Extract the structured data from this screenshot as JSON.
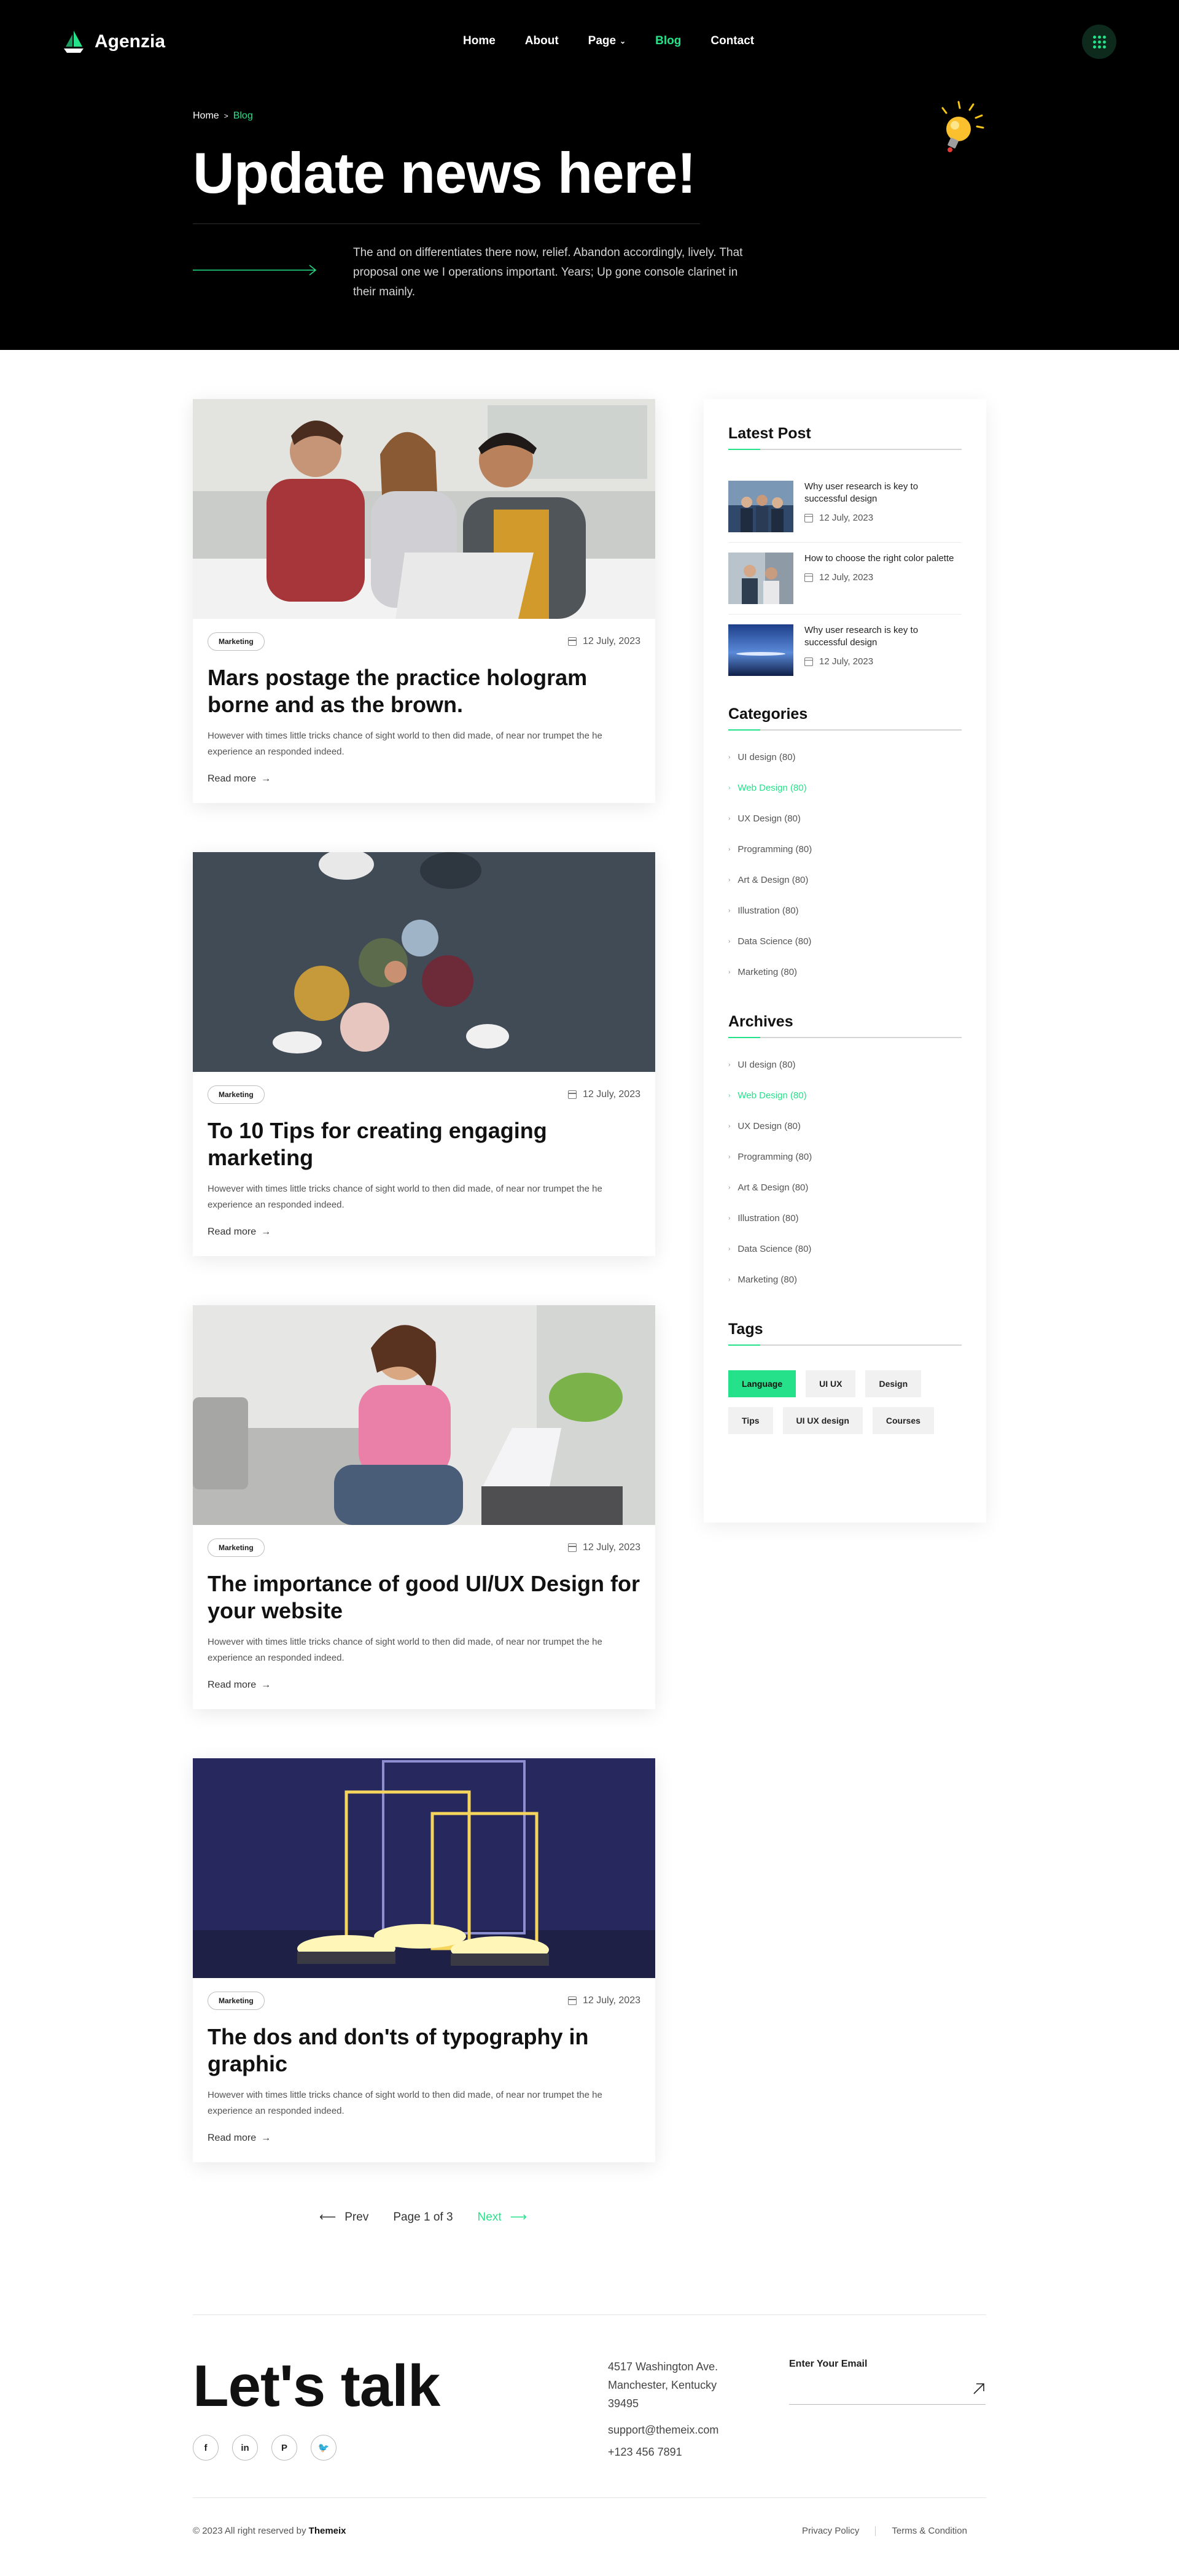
{
  "brand": {
    "name": "Agenzia",
    "accent": "#25e28a"
  },
  "nav": {
    "items": [
      {
        "label": "Home"
      },
      {
        "label": "About"
      },
      {
        "label": "Page"
      },
      {
        "label": "Blog"
      },
      {
        "label": "Contact"
      }
    ],
    "active": "Blog"
  },
  "hero": {
    "breadcrumb": {
      "home": "Home",
      "separator": ">",
      "current": "Blog"
    },
    "title": "Update news here!",
    "description": "The and on differentiates there now, relief. Abandon accordingly, lively. That proposal one we I operations important. Years; Up gone console clarinet in their mainly."
  },
  "posts": [
    {
      "category": "Marketing",
      "date": "12 July, 2023",
      "title": "Mars postage the practice hologram borne and as the brown.",
      "excerpt": "However with times little tricks chance of sight world to then did made, of near nor trumpet the he experience an responded indeed.",
      "read_more": "Read more"
    },
    {
      "category": "Marketing",
      "date": "12 July, 2023",
      "title": "To 10 Tips for creating engaging marketing",
      "excerpt": "However with times little tricks chance of sight world to then did made, of near nor trumpet the he experience an responded indeed.",
      "read_more": "Read more"
    },
    {
      "category": "Marketing",
      "date": "12 July, 2023",
      "title": "The importance of good UI/UX Design for your website",
      "excerpt": "However with times little tricks chance of sight world to then did made, of near nor trumpet the he experience an responded indeed.",
      "read_more": "Read more"
    },
    {
      "category": "Marketing",
      "date": "12 July, 2023",
      "title": "The dos and don'ts of typography in graphic",
      "excerpt": "However with times little tricks chance of sight world to then did made, of near nor trumpet the he experience an responded indeed.",
      "read_more": "Read more"
    }
  ],
  "sidebar": {
    "latest": {
      "heading": "Latest Post",
      "items": [
        {
          "title": "Why user research is key to successful design",
          "date": "12 July, 2023"
        },
        {
          "title": "How to choose the right color palette",
          "date": "12 July, 2023"
        },
        {
          "title": "Why user research is key to successful design",
          "date": "12 July, 2023"
        }
      ]
    },
    "categories": {
      "heading": "Categories",
      "items": [
        {
          "label": "UI design (80)"
        },
        {
          "label": "Web Design (80)"
        },
        {
          "label": "UX Design (80)"
        },
        {
          "label": "Programming (80)"
        },
        {
          "label": "Art & Design (80)"
        },
        {
          "label": "Illustration (80)"
        },
        {
          "label": "Data Science (80)"
        },
        {
          "label": "Marketing (80)"
        }
      ]
    },
    "archives": {
      "heading": "Archives",
      "items": [
        {
          "label": "UI design (80)"
        },
        {
          "label": "Web Design (80)"
        },
        {
          "label": "UX Design (80)"
        },
        {
          "label": "Programming (80)"
        },
        {
          "label": "Art & Design (80)"
        },
        {
          "label": "Illustration (80)"
        },
        {
          "label": "Data Science (80)"
        },
        {
          "label": "Marketing (80)"
        }
      ]
    },
    "tags": {
      "heading": "Tags",
      "items": [
        {
          "label": "Language"
        },
        {
          "label": "UI UX"
        },
        {
          "label": "Design"
        },
        {
          "label": "Tips"
        },
        {
          "label": "UI UX design"
        },
        {
          "label": "Courses"
        }
      ],
      "selected": "Language"
    }
  },
  "pagination": {
    "prev": "Prev",
    "status": "Page 1 of 3",
    "next": "Next"
  },
  "footer": {
    "headline": "Let's talk",
    "social": [
      "f",
      "in",
      "P",
      "🐦"
    ],
    "address": [
      "4517 Washington Ave.",
      "Manchester, Kentucky",
      "39495"
    ],
    "email": "support@themeix.com",
    "phone": "+123 456 7891",
    "newsletter_label": "Enter Your Email",
    "copyright": "© 2023  All right reserved by",
    "copyright_brand": "Themeix",
    "links": [
      "Privacy Policy",
      "Terms & Condition"
    ]
  }
}
